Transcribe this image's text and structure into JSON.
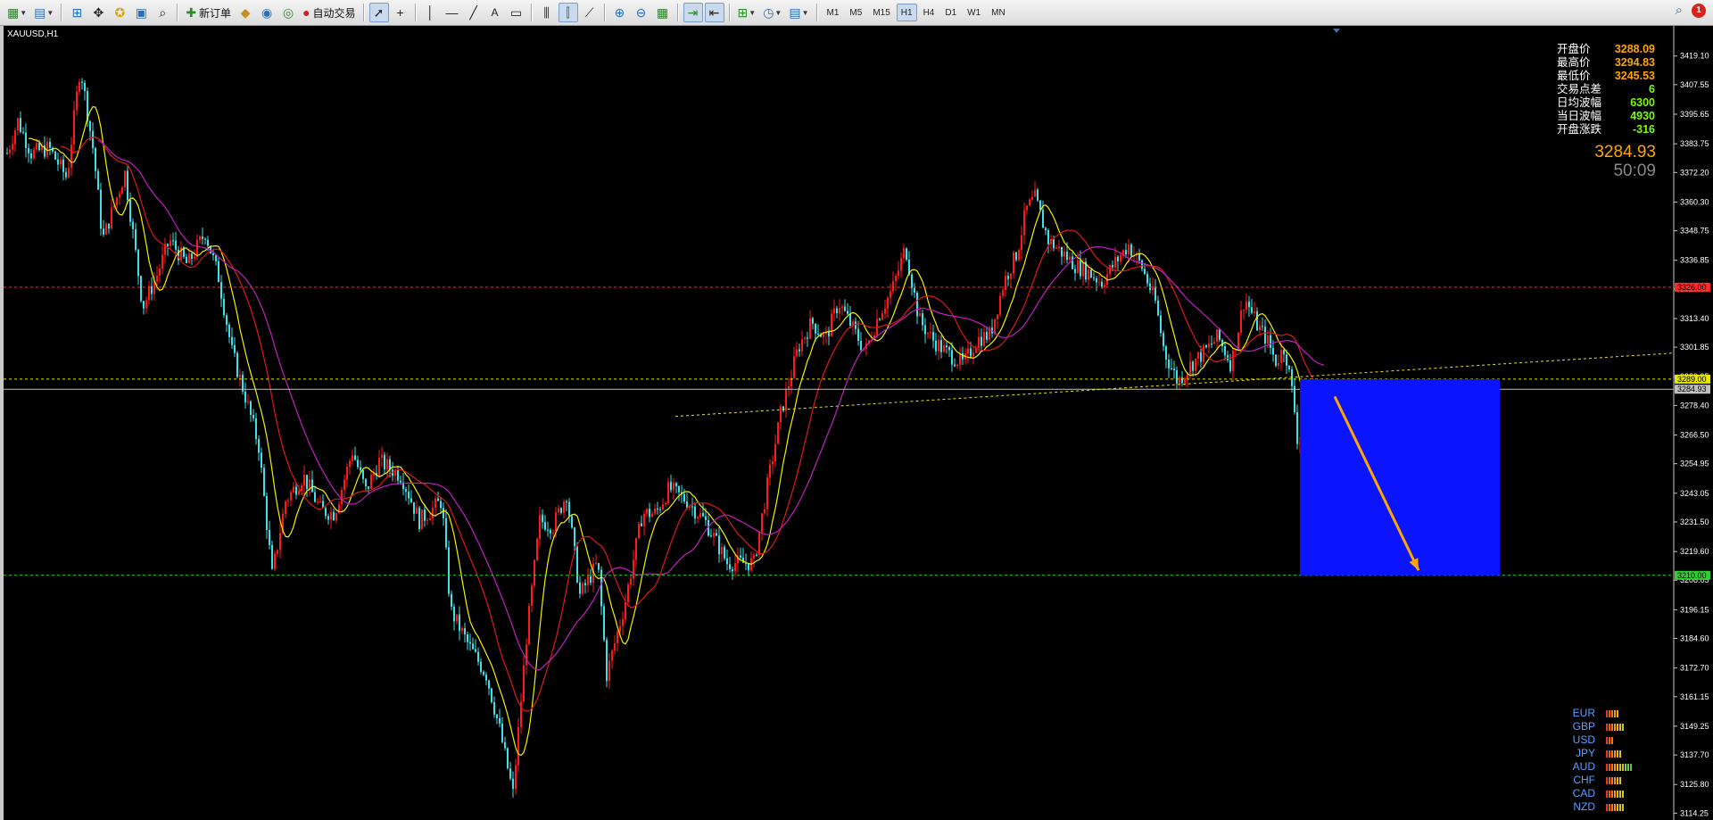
{
  "toolbar": {
    "new_order_label": "新订单",
    "auto_trade_label": "自动交易",
    "timeframes": [
      "M1",
      "M5",
      "M15",
      "H1",
      "H4",
      "D1",
      "W1",
      "MN"
    ],
    "active_timeframe": "H1",
    "notification_count": "1"
  },
  "chart": {
    "symbol_label": "XAUUSD,H1",
    "big_price": "3284.93",
    "timer": "50:09",
    "info": [
      {
        "label": "开盘价",
        "value": "3288.09"
      },
      {
        "label": "最高价",
        "value": "3294.83"
      },
      {
        "label": "最低价",
        "value": "3245.53"
      },
      {
        "label": "交易点差",
        "value": "6"
      },
      {
        "label": "日均波幅",
        "value": "6300"
      },
      {
        "label": "当日波幅",
        "value": "4930"
      },
      {
        "label": "开盘涨跌",
        "value": "-316"
      }
    ],
    "currencies": [
      {
        "name": "EUR",
        "strength": 5
      },
      {
        "name": "GBP",
        "strength": 7
      },
      {
        "name": "USD",
        "strength": 3
      },
      {
        "name": "JPY",
        "strength": 6
      },
      {
        "name": "AUD",
        "strength": 10
      },
      {
        "name": "CHF",
        "strength": 6
      },
      {
        "name": "CAD",
        "strength": 7
      },
      {
        "name": "NZD",
        "strength": 7
      }
    ],
    "y_ticks": [
      "3419.10",
      "3407.55",
      "3395.65",
      "3383.75",
      "3372.20",
      "3360.30",
      "3348.75",
      "3336.85",
      "3325.30",
      "3313.40",
      "3301.85",
      "3289.95",
      "3278.40",
      "3266.50",
      "3254.95",
      "3243.05",
      "3231.50",
      "3219.60",
      "3208.05",
      "3196.15",
      "3184.60",
      "3172.70",
      "3161.15",
      "3149.25",
      "3137.70",
      "3125.80",
      "3114.25"
    ],
    "price_range": [
      3111.5,
      3430.5
    ],
    "levels": [
      {
        "price": 3326.0,
        "label": "3326.00",
        "color": "#ff2a2a",
        "style": "dashed"
      },
      {
        "price": 3289.0,
        "label": "3289.00",
        "color": "#e6e600",
        "style": "dashed"
      },
      {
        "price": 3284.93,
        "label": "3284.93",
        "color": "#c0c0c0",
        "style": "solid"
      },
      {
        "price": 3210.0,
        "label": "3210.00",
        "color": "#33cc33",
        "style": "dashed"
      }
    ],
    "colors": {
      "bull": "#ff1a1a",
      "bear": "#40e0e8",
      "ma_fast": "#f2f200",
      "ma_mid": "#e01818",
      "ma_slow": "#c020c0",
      "box": "#0a14ff",
      "arrow": "#ffa500"
    }
  }
}
